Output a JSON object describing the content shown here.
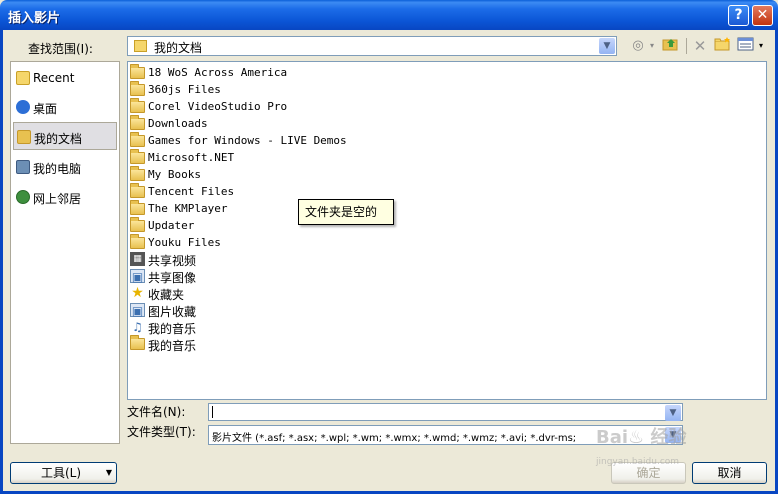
{
  "window": {
    "title": "插入影片",
    "help_glyph": "?",
    "close_glyph": "✕"
  },
  "lookin": {
    "label": "查找范围(I):",
    "value": "我的文档"
  },
  "places": [
    {
      "label": "Recent",
      "icon": "recent-icon",
      "color": "#C9A027"
    },
    {
      "label": "桌面",
      "icon": "desktop-icon",
      "color": "#2D6FD6"
    },
    {
      "label": "我的文档",
      "icon": "my-documents-icon",
      "color": "#E8C150"
    },
    {
      "label": "我的电脑",
      "icon": "my-computer-icon",
      "color": "#6C8FB5"
    },
    {
      "label": "网上邻居",
      "icon": "network-icon",
      "color": "#3E8F3E"
    }
  ],
  "files": [
    {
      "name": "18 WoS Across America",
      "icon": "folder-icon"
    },
    {
      "name": "360js Files",
      "icon": "folder-icon"
    },
    {
      "name": "Corel VideoStudio Pro",
      "icon": "folder-icon"
    },
    {
      "name": "Downloads",
      "icon": "folder-icon"
    },
    {
      "name": "Games for Windows - LIVE Demos",
      "icon": "folder-icon"
    },
    {
      "name": "Microsoft.NET",
      "icon": "folder-icon"
    },
    {
      "name": "My Books",
      "icon": "folder-icon"
    },
    {
      "name": "Tencent Files",
      "icon": "folder-icon"
    },
    {
      "name": "The KMPlayer",
      "icon": "folder-icon"
    },
    {
      "name": "Updater",
      "icon": "folder-icon"
    },
    {
      "name": "Youku Files",
      "icon": "folder-icon"
    },
    {
      "name": "共享视频",
      "icon": "shared-video-icon"
    },
    {
      "name": "共享图像",
      "icon": "shared-pictures-icon"
    },
    {
      "name": "收藏夹",
      "icon": "favorites-icon"
    },
    {
      "name": "图片收藏",
      "icon": "my-pictures-icon"
    },
    {
      "name": "我的音乐",
      "icon": "my-music-icon"
    },
    {
      "name": "我的音乐",
      "icon": "folder-icon"
    }
  ],
  "tooltip": "文件夹是空的",
  "filename": {
    "label": "文件名(N):",
    "value": ""
  },
  "filetype": {
    "label": "文件类型(T):",
    "value": "影片文件 (*.asf; *.asx; *.wpl; *.wm; *.wmx; *.wmd; *.wmz; *.avi; *.dvr-ms;"
  },
  "buttons": {
    "ok": "确定",
    "cancel": "取消",
    "tools": "工具(L)"
  },
  "watermark": {
    "text": "Bai♨ 经验",
    "sub": "jingyan.baidu.com"
  }
}
